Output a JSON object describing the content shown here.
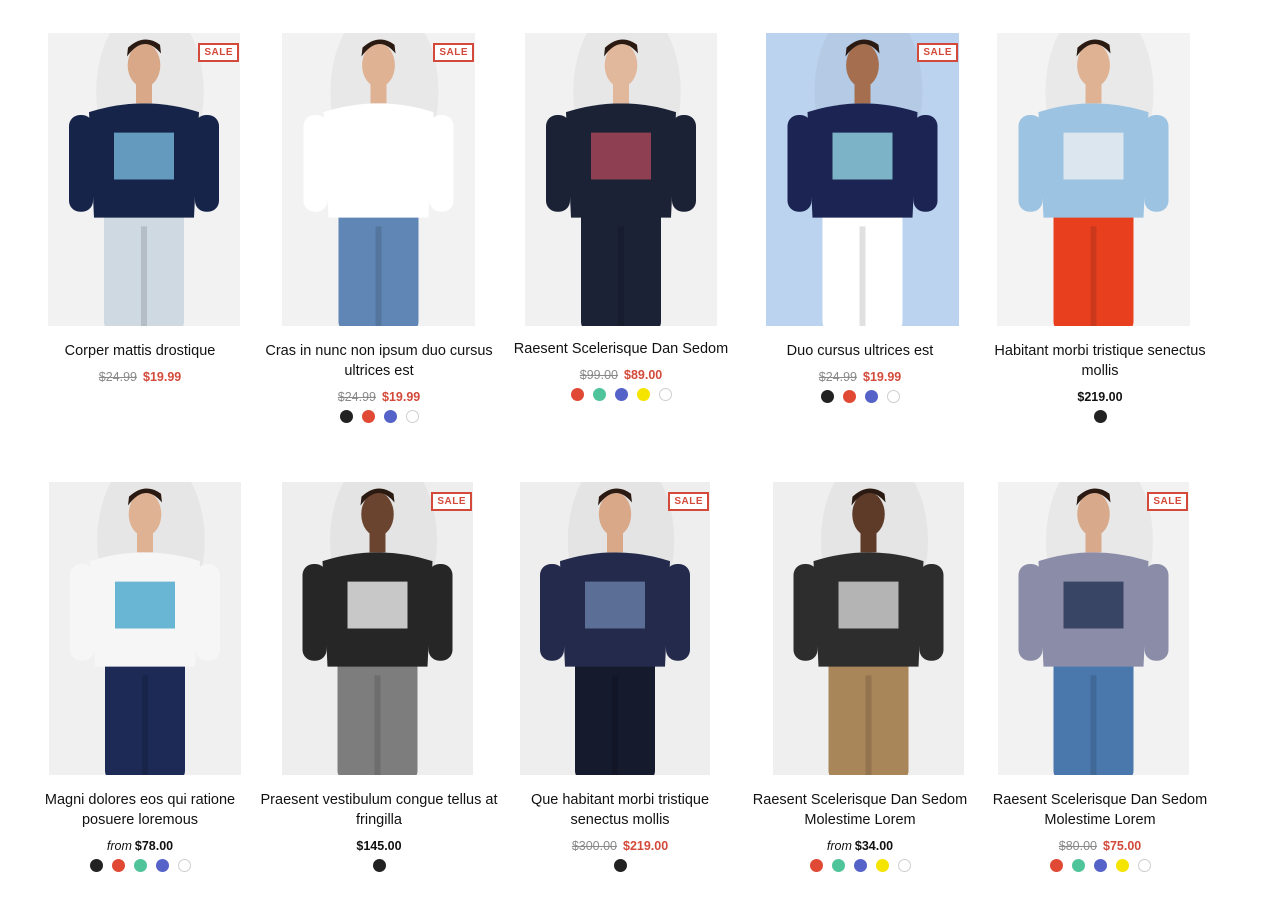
{
  "sale_label": "SALE",
  "from_label": "from",
  "colors": {
    "sale": "#d44a3a",
    "black": "#222222",
    "red": "#e04a35",
    "green": "#4fc49b",
    "blue": "#5563c9",
    "yellow": "#f5e400",
    "white": "#ffffff"
  },
  "products": [
    {
      "title": "Corper mattis drostique",
      "old_price": "$24.99",
      "price": "$19.99",
      "sale": true,
      "swatches": [],
      "image": "navy-graphic-tee"
    },
    {
      "title": "Cras in nunc non ipsum duo cursus ultrices est",
      "old_price": "$24.99",
      "price": "$19.99",
      "sale": true,
      "swatches": [
        "black",
        "red",
        "blue",
        "white"
      ],
      "image": "blue-chinos"
    },
    {
      "title": "Raesent Scelerisque Dan Sedom",
      "old_price": "$99.00",
      "price": "$89.00",
      "sale": false,
      "swatches": [
        "red",
        "green",
        "blue",
        "yellow",
        "white"
      ],
      "image": "navy-hooded-jacket"
    },
    {
      "title": "Duo cursus ultrices est",
      "old_price": "$24.99",
      "price": "$19.99",
      "sale": true,
      "swatches": [
        "black",
        "red",
        "blue",
        "white"
      ],
      "image": "striped-polo"
    },
    {
      "title": "Habitant morbi tristique senectus mollis",
      "old_price": "",
      "price": "$219.00",
      "sale": false,
      "swatches": [
        "black"
      ],
      "image": "denim-jacket"
    },
    {
      "title": "Magni dolores eos qui ratione posuere loremous",
      "from": true,
      "price": "$78.00",
      "sale": false,
      "swatches": [
        "black",
        "red",
        "green",
        "blue",
        "white"
      ],
      "image": "white-graphic-tee"
    },
    {
      "title": "Praesent vestibulum congue tellus at fringilla",
      "old_price": "",
      "price": "$145.00",
      "sale": true,
      "swatches": [
        "black"
      ],
      "image": "charcoal-blazer"
    },
    {
      "title": "Que habitant morbi tristique senectus mollis",
      "old_price": "$300.00",
      "price": "$219.00",
      "sale": true,
      "swatches": [
        "black"
      ],
      "image": "navy-blazer"
    },
    {
      "title": "Raesent Scelerisque Dan Sedom Molestime Lorem",
      "from": true,
      "price": "$34.00",
      "sale": false,
      "swatches": [
        "red",
        "green",
        "blue",
        "yellow",
        "white"
      ],
      "image": "floral-stripe-tee"
    },
    {
      "title": "Raesent Scelerisque Dan Sedom Molestime Lorem",
      "old_price": "$80.00",
      "price": "$75.00",
      "sale": true,
      "swatches": [
        "red",
        "green",
        "blue",
        "yellow",
        "white"
      ],
      "image": "denim-shorts"
    }
  ]
}
